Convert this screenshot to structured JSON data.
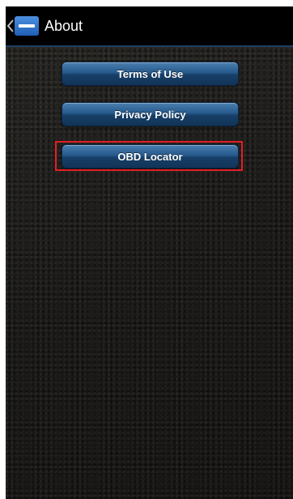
{
  "action_bar": {
    "title": "About",
    "back_icon": "chevron-left-icon",
    "app_icon": "app-logo-icon"
  },
  "menu": {
    "items": [
      {
        "label": "Terms of Use"
      },
      {
        "label": "Privacy Policy"
      },
      {
        "label": "OBD Locator",
        "highlighted": true
      }
    ]
  },
  "colors": {
    "action_bar": "#000000",
    "button": "#275a8c",
    "highlight": "#e31f26"
  }
}
